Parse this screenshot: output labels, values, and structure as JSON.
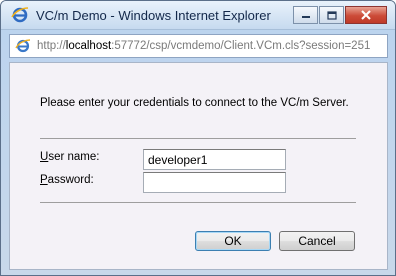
{
  "window": {
    "title": "VC/m Demo - Windows Internet Explorer",
    "controls": {
      "minimize": "minimize",
      "maximize": "maximize",
      "close": "close"
    }
  },
  "address_bar": {
    "prefix": "http://",
    "host": "localhost",
    "rest": ":57772/csp/vcmdemo/Client.VCm.cls?session=251"
  },
  "dialog": {
    "prompt": "Please enter your credentials to connect to the VC/m Server.",
    "username_label_key": "U",
    "username_label_rest": "ser name:",
    "username_value": "developer1",
    "password_label_key": "P",
    "password_label_rest": "assword:",
    "password_value": "",
    "ok_label": "OK",
    "cancel_label": "Cancel"
  },
  "icons": {
    "browser": "ie-icon",
    "page": "page-icon",
    "minimize": "minimize-icon",
    "maximize": "maximize-icon",
    "close": "close-icon"
  },
  "colors": {
    "window_frame": "#5b6f89",
    "content_background": "#f4f2f7",
    "close_button": "#cc4b38",
    "text": "#000000"
  }
}
